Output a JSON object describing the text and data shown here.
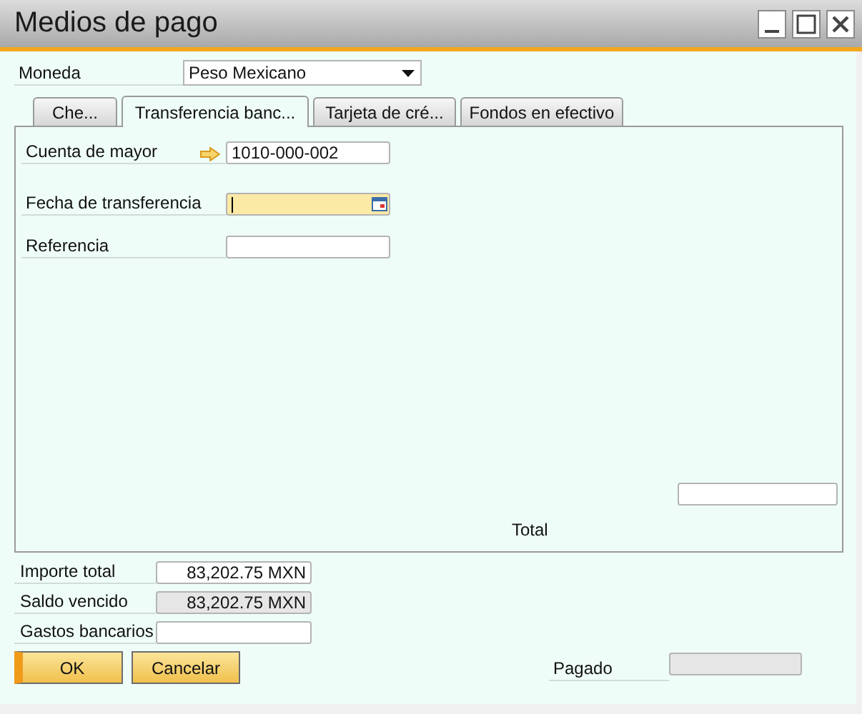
{
  "window": {
    "title": "Medios de pago"
  },
  "currency": {
    "label": "Moneda",
    "value": "Peso Mexicano"
  },
  "tabs": [
    {
      "label": "Che...",
      "selected": false
    },
    {
      "label": "Transferencia banc...",
      "selected": true
    },
    {
      "label": "Tarjeta de cré...",
      "selected": false
    },
    {
      "label": "Fondos en efectivo",
      "selected": false
    }
  ],
  "transfer_fields": [
    {
      "kind": "account",
      "label": "Cuenta de mayor",
      "value": "1010-000-002",
      "focused": false
    },
    {
      "kind": "date",
      "label": "Fecha de transferencia",
      "focused": true
    },
    {
      "kind": "text",
      "label": "Referencia",
      "focused": false
    }
  ],
  "total": {
    "label": "Total"
  },
  "summary": [
    {
      "label": "Importe total",
      "value": "83,202.75 MXN",
      "disabled": false
    },
    {
      "label": "Saldo vencido",
      "value": "83,202.75 MXN",
      "disabled": true
    },
    {
      "label": "Gastos bancarios",
      "disabled": false
    }
  ],
  "buttons": [
    {
      "label": "OK",
      "default": true
    },
    {
      "label": "Cancelar",
      "default": false
    }
  ],
  "paid": {
    "label": "Pagado",
    "disabled": true
  }
}
